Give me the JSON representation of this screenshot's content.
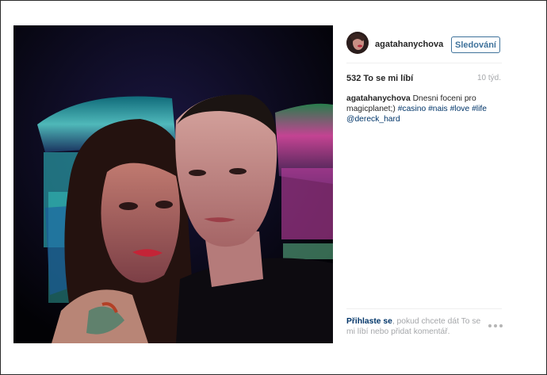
{
  "post": {
    "username": "agatahanychova",
    "follow_label": "Sledování",
    "likes": "532 To se mi líbí",
    "age": "10 týd.",
    "caption_user": "agatahanychova",
    "caption_text_1": " Dnesni foceni pro magicplanet;) ",
    "caption_tags": [
      "#casino",
      "#nais",
      "#love",
      "#life"
    ],
    "caption_mention": "@dereck_hard",
    "login_link": "Přihlaste se",
    "login_text": ", pokud chcete dát To se mi líbí nebo přidat komentář."
  },
  "icons": {
    "avatar": "profile-avatar",
    "more": "more-options-icon"
  },
  "colors": {
    "link": "#003569",
    "follow": "#3f729b",
    "muted": "#a5a7aa"
  }
}
